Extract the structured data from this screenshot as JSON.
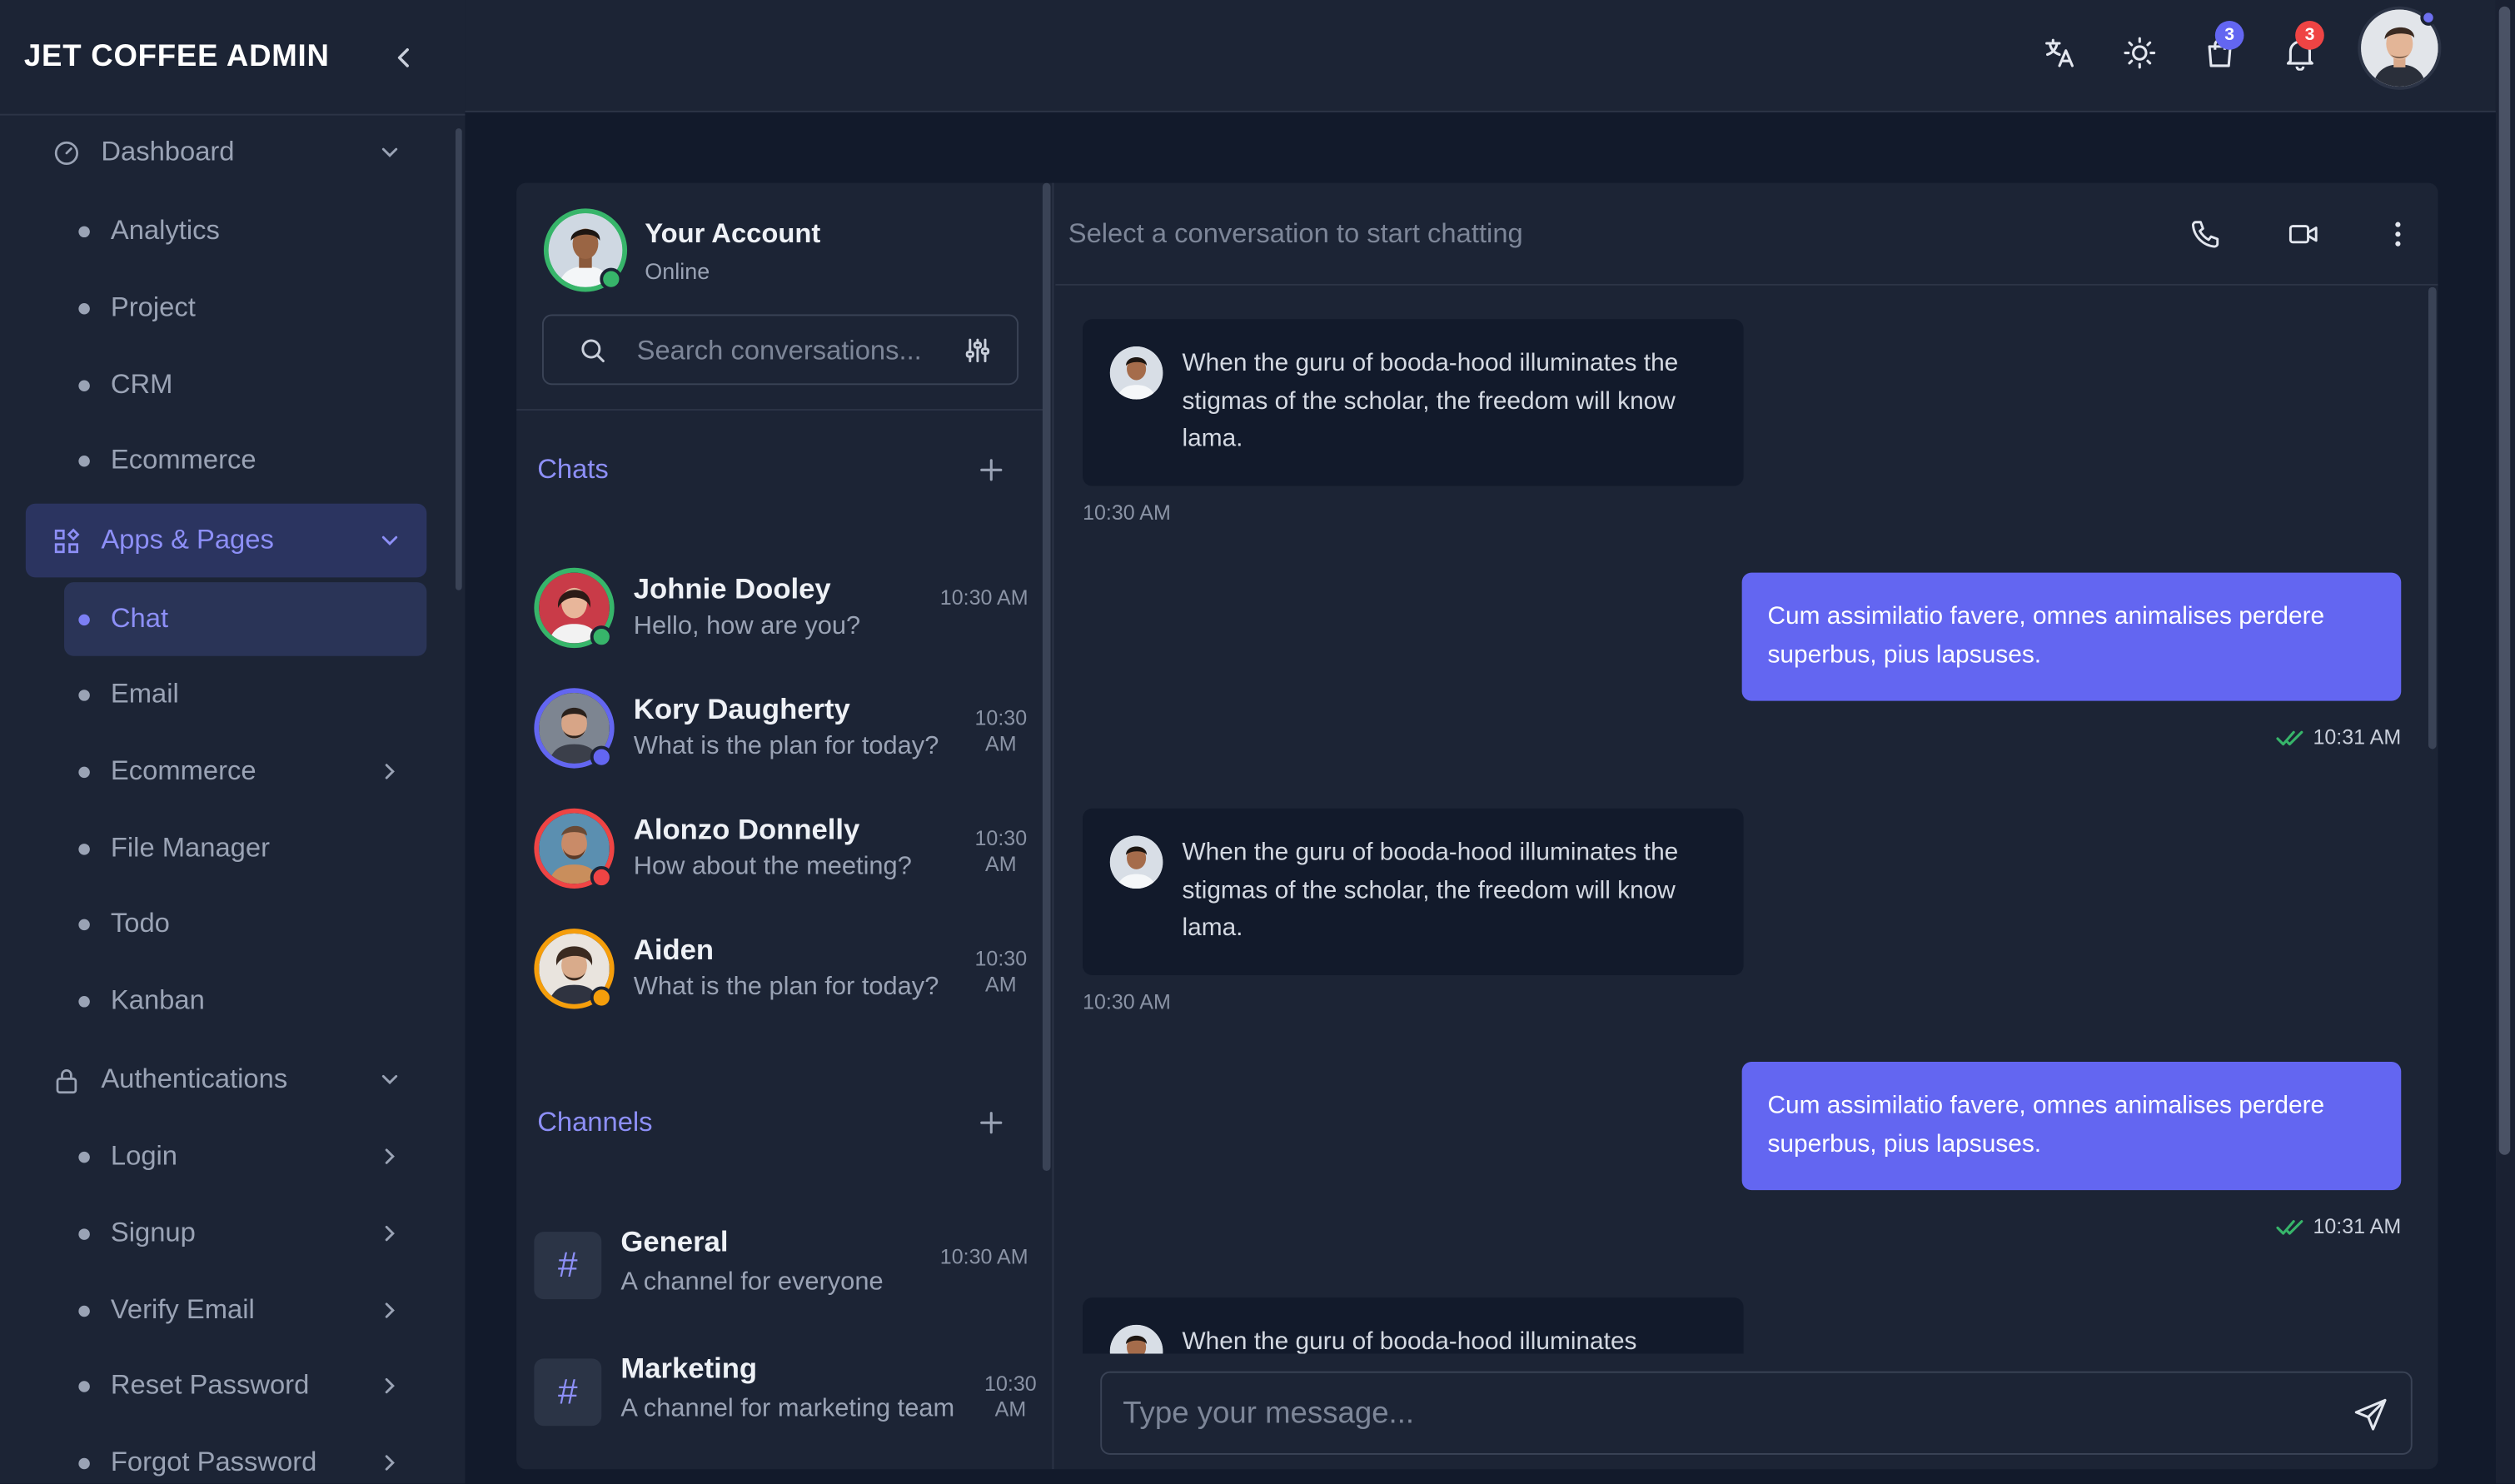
{
  "app": {
    "brand": "JET COFFEE ADMIN"
  },
  "sidebar": {
    "items": [
      {
        "label": "Dashboard",
        "type": "group",
        "icon": "dashboard-icon"
      },
      {
        "label": "Analytics",
        "type": "sub"
      },
      {
        "label": "Project",
        "type": "sub"
      },
      {
        "label": "CRM",
        "type": "sub"
      },
      {
        "label": "Ecommerce",
        "type": "sub"
      },
      {
        "label": "Apps & Pages",
        "type": "group",
        "icon": "apps-icon",
        "state": "expanded"
      },
      {
        "label": "Chat",
        "type": "sub",
        "state": "active"
      },
      {
        "label": "Email",
        "type": "sub"
      },
      {
        "label": "Ecommerce",
        "type": "sub",
        "has_children": true
      },
      {
        "label": "File Manager",
        "type": "sub"
      },
      {
        "label": "Todo",
        "type": "sub"
      },
      {
        "label": "Kanban",
        "type": "sub"
      },
      {
        "label": "Authentications",
        "type": "group",
        "icon": "lock-icon"
      },
      {
        "label": "Login",
        "type": "sub",
        "has_children": true
      },
      {
        "label": "Signup",
        "type": "sub",
        "has_children": true
      },
      {
        "label": "Verify Email",
        "type": "sub",
        "has_children": true
      },
      {
        "label": "Reset Password",
        "type": "sub",
        "has_children": true
      },
      {
        "label": "Forgot Password",
        "type": "sub",
        "has_children": true
      }
    ]
  },
  "topbar": {
    "cart_badge": "3",
    "notification_badge": "3",
    "icons": [
      "translate-icon",
      "sun-icon",
      "shopping-bag-icon",
      "bell-icon"
    ]
  },
  "account": {
    "name": "Your Account",
    "status": "Online"
  },
  "search": {
    "placeholder": "Search conversations..."
  },
  "chats_section": {
    "title": "Chats"
  },
  "chats": [
    {
      "name": "Johnie Dooley",
      "preview": "Hello, how are you?",
      "time": "10:30 AM",
      "status_color": "#37b56a"
    },
    {
      "name": "Kory Daugherty",
      "preview": "What is the plan for today?",
      "time": "10:30 AM",
      "status_color": "#6366f1"
    },
    {
      "name": "Alonzo Donnelly",
      "preview": "How about the meeting?",
      "time": "10:30 AM",
      "status_color": "#ef4444"
    },
    {
      "name": "Aiden",
      "preview": "What is the plan for today?",
      "time": "10:30 AM",
      "status_color": "#f59e0b"
    }
  ],
  "channels_section": {
    "title": "Channels"
  },
  "channels": [
    {
      "name": "General",
      "description": "A channel for everyone",
      "time": "10:30 AM"
    },
    {
      "name": "Marketing",
      "description": "A channel for marketing team",
      "time": "10:30 AM"
    }
  ],
  "conversation": {
    "header": "Select a conversation to start chatting",
    "messages": [
      {
        "direction": "in",
        "text": "When the guru of booda-hood illuminates the stigmas of the scholar, the freedom will know lama.",
        "time": "10:30 AM"
      },
      {
        "direction": "out",
        "text": "Cum assimilatio favere, omnes animalises perdere superbus, pius lapsuses.",
        "time": "10:31 AM"
      },
      {
        "direction": "in",
        "text": "When the guru of booda-hood illuminates the stigmas of the scholar, the freedom will know lama.",
        "time": "10:30 AM"
      },
      {
        "direction": "out",
        "text": "Cum assimilatio favere, omnes animalises perdere superbus, pius lapsuses.",
        "time": "10:31 AM"
      },
      {
        "direction": "in",
        "text": "When the guru of booda-hood illuminates",
        "time": ""
      }
    ]
  },
  "composer": {
    "placeholder": "Type your message..."
  },
  "colors": {
    "accent": "#6366f1",
    "sidebar_bg": "#1c2435",
    "page_bg": "#121a2b",
    "online": "#37b56a"
  }
}
